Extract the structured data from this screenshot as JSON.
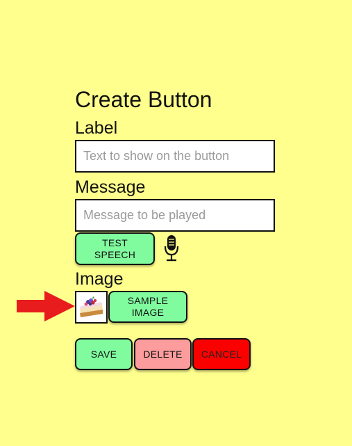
{
  "dialog": {
    "title": "Create Button",
    "label_heading": "Label",
    "label_placeholder": "Text to show on the button",
    "label_value": "",
    "message_heading": "Message",
    "message_placeholder": "Message to be played",
    "message_value": "",
    "test_speech_label": "TEST SPEECH",
    "image_heading": "Image",
    "sample_image_label": "SAMPLE IMAGE",
    "save_label": "SAVE",
    "delete_label": "DELETE",
    "cancel_label": "CANCEL"
  },
  "icons": {
    "microphone": "microphone-icon",
    "arrow": "red-arrow-pointer",
    "thumbnail": "cake-image-thumbnail"
  },
  "colors": {
    "background": "#ffff8d",
    "green_button": "#80fc9e",
    "delete_button": "#fc9c9c",
    "cancel_button": "#fc0000",
    "arrow": "#e81c1c"
  }
}
